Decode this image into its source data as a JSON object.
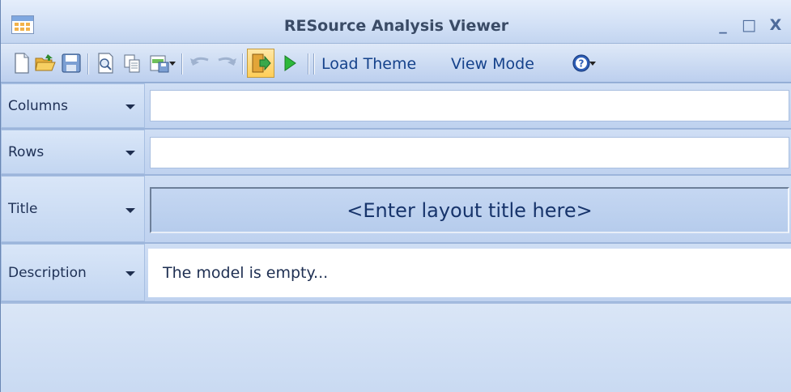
{
  "window": {
    "title": "RESource Analysis Viewer",
    "minimize_glyph": "_",
    "maximize_glyph": "□",
    "close_glyph": "X"
  },
  "toolbar": {
    "icons": [
      "new-document-icon",
      "open-folder-icon",
      "save-icon",
      "print-preview-icon",
      "copy-icon",
      "export-icon",
      "undo-icon",
      "redo-icon",
      "exit-icon",
      "run-icon",
      "help-icon"
    ],
    "load_theme_label": "Load Theme",
    "view_mode_label": "View Mode"
  },
  "fields": {
    "columns": {
      "label": "Columns",
      "value": ""
    },
    "rows": {
      "label": "Rows",
      "value": ""
    },
    "title": {
      "label": "Title",
      "value": "<Enter layout title here>"
    },
    "description": {
      "label": "Description",
      "value": "The model is empty..."
    }
  },
  "colors": {
    "accent": "#15428b",
    "toolbar_bg": "#cddcf3",
    "active_button": "#ffce58"
  }
}
